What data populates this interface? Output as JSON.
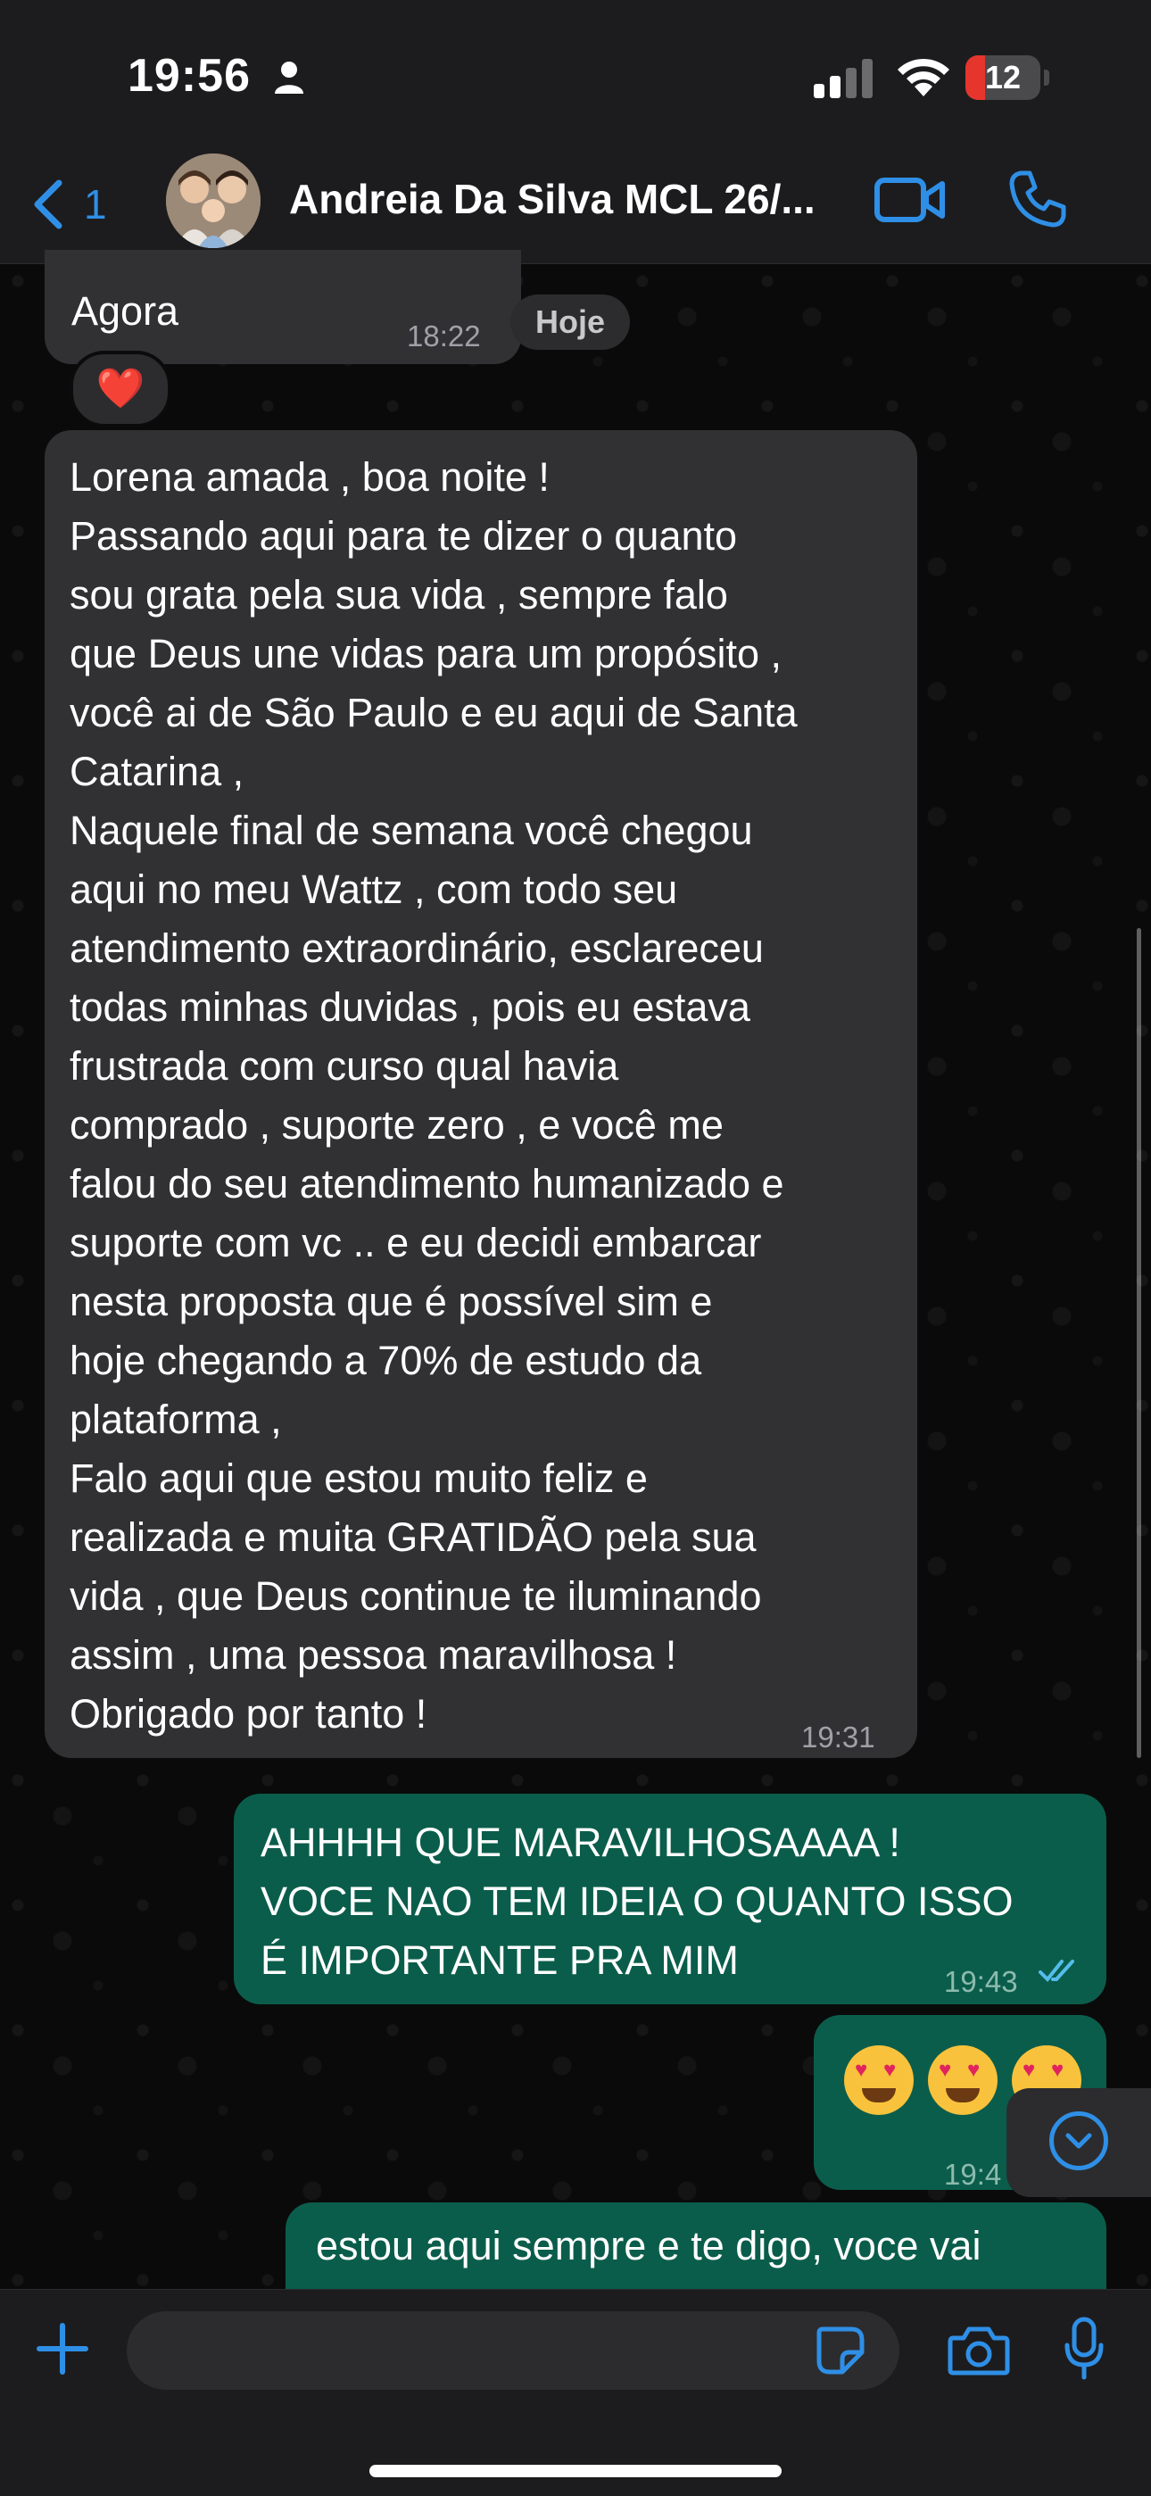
{
  "status_bar": {
    "time": "19:56",
    "battery": "12",
    "battery_level": 0.12,
    "icons": [
      "person-icon",
      "cellular-signal-icon",
      "wifi-icon",
      "battery-icon"
    ]
  },
  "header": {
    "back_count": "1",
    "contact_name": "Andreia Da Silva MCL 26/...",
    "icons": [
      "back-chevron-icon",
      "video-call-icon",
      "phone-icon"
    ]
  },
  "chat": {
    "date_chip": "Hoje",
    "partial_message": {
      "text": "Agora",
      "time": "18:22"
    },
    "reaction": "❤️",
    "incoming_message": {
      "lines": [
        "Lorena amada , boa noite !",
        "Passando aqui para te dizer o quanto",
        "sou grata pela sua vida , sempre falo",
        "que Deus une vidas para um propósito ,",
        "você ai de São Paulo e eu aqui de Santa",
        "Catarina ,",
        "Naquele final de semana você chegou",
        "aqui no meu Wattz , com todo seu",
        "atendimento extraordinário, esclareceu",
        "todas minhas duvidas , pois eu estava",
        "frustrada com curso qual havia",
        "comprado , suporte zero , e você me",
        "falou do seu atendimento humanizado e",
        "suporte com vc .. e eu decidi embarcar",
        "nesta proposta que é possível sim e",
        "hoje chegando a 70% de estudo da",
        "plataforma ,",
        "Falo aqui que estou muito feliz e",
        "realizada e muita GRATIDÃO pela sua",
        "vida , que Deus continue te iluminando",
        "assim , uma pessoa maravilhosa !",
        "Obrigado por tanto !"
      ],
      "time": "19:31"
    },
    "outgoing_message_1": {
      "lines": [
        "AHHHH QUE MARAVILHOSAAAA !",
        "VOCE NAO TEM IDEIA O QUANTO ISSO",
        "É IMPORTANTE PRA MIM"
      ],
      "time": "19:43",
      "status": "read"
    },
    "outgoing_message_2": {
      "emoji_count": 3,
      "time": "19:4"
    },
    "outgoing_message_3": {
      "text": "estou aqui sempre e te digo, voce vai"
    }
  },
  "input_bar": {
    "placeholder": "",
    "icons": [
      "plus-icon",
      "sticker-icon",
      "camera-icon",
      "microphone-icon"
    ]
  },
  "colors": {
    "accent": "#2f8fe6",
    "incoming_bubble": "#313133",
    "outgoing_bubble": "#0b5d4b",
    "bar_background": "#1c1c1e",
    "battery_low": "#e5352c"
  }
}
